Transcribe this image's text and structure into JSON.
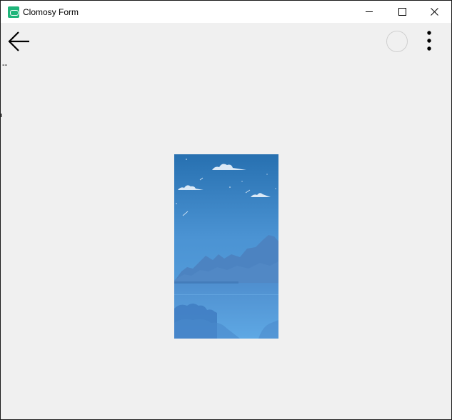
{
  "window": {
    "title": "Clomosy Form",
    "app_icon": "clomosy-app-icon"
  },
  "titlebar_buttons": {
    "minimize": "minimize-icon",
    "maximize": "maximize-icon",
    "close": "close-icon"
  },
  "toolbar": {
    "back": "arrow-left-icon",
    "status": "circle-icon",
    "menu": "more-vertical-icon"
  },
  "content": {
    "stray_text": "--",
    "image": "sky-mountains-illustration"
  },
  "colors": {
    "window_bg": "#f0f0f0",
    "titlebar_bg": "#ffffff",
    "app_icon": "#1fb57a",
    "sky_top": "#2a76b8",
    "sky_bottom": "#5aa6e0"
  }
}
